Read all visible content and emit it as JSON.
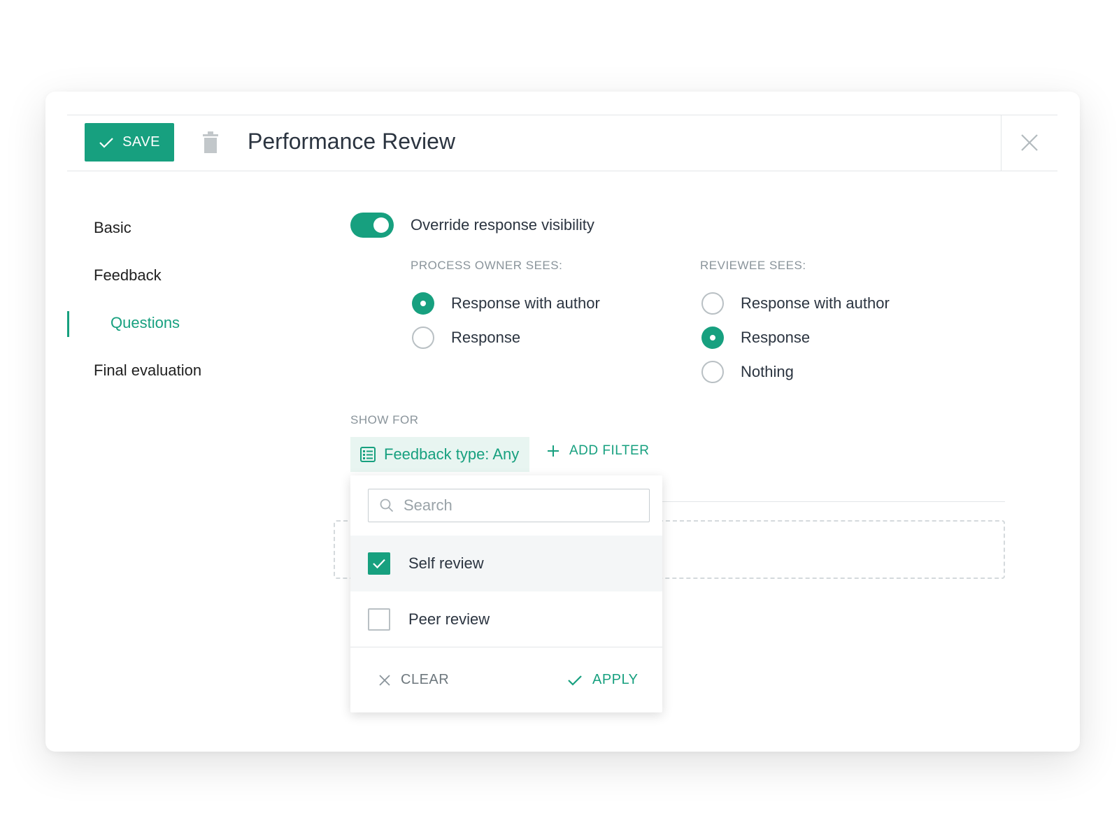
{
  "header": {
    "save_label": "SAVE",
    "title": "Performance Review"
  },
  "sidebar": {
    "items": [
      {
        "label": "Basic"
      },
      {
        "label": "Feedback"
      },
      {
        "label": "Questions",
        "active": true
      },
      {
        "label": "Final evaluation"
      }
    ]
  },
  "visibility": {
    "toggle_label": "Override response visibility",
    "toggle_on": true,
    "process_owner": {
      "label": "PROCESS OWNER SEES:",
      "options": [
        {
          "label": "Response with author",
          "selected": true
        },
        {
          "label": "Response",
          "selected": false
        }
      ]
    },
    "reviewee": {
      "label": "REVIEWEE SEES:",
      "options": [
        {
          "label": "Response with author",
          "selected": false
        },
        {
          "label": "Response",
          "selected": true
        },
        {
          "label": "Nothing",
          "selected": false
        }
      ]
    }
  },
  "show_for": {
    "label": "SHOW FOR",
    "filter_chip": "Feedback type: Any",
    "add_filter": "ADD FILTER"
  },
  "dropdown": {
    "search_placeholder": "Search",
    "options": [
      {
        "label": "Self review",
        "checked": true
      },
      {
        "label": "Peer review",
        "checked": false
      }
    ],
    "clear_label": "CLEAR",
    "apply_label": "APPLY"
  },
  "colors": {
    "accent": "#17a07f",
    "chip_bg": "#e8f5f1",
    "muted_text": "#8a949b"
  }
}
